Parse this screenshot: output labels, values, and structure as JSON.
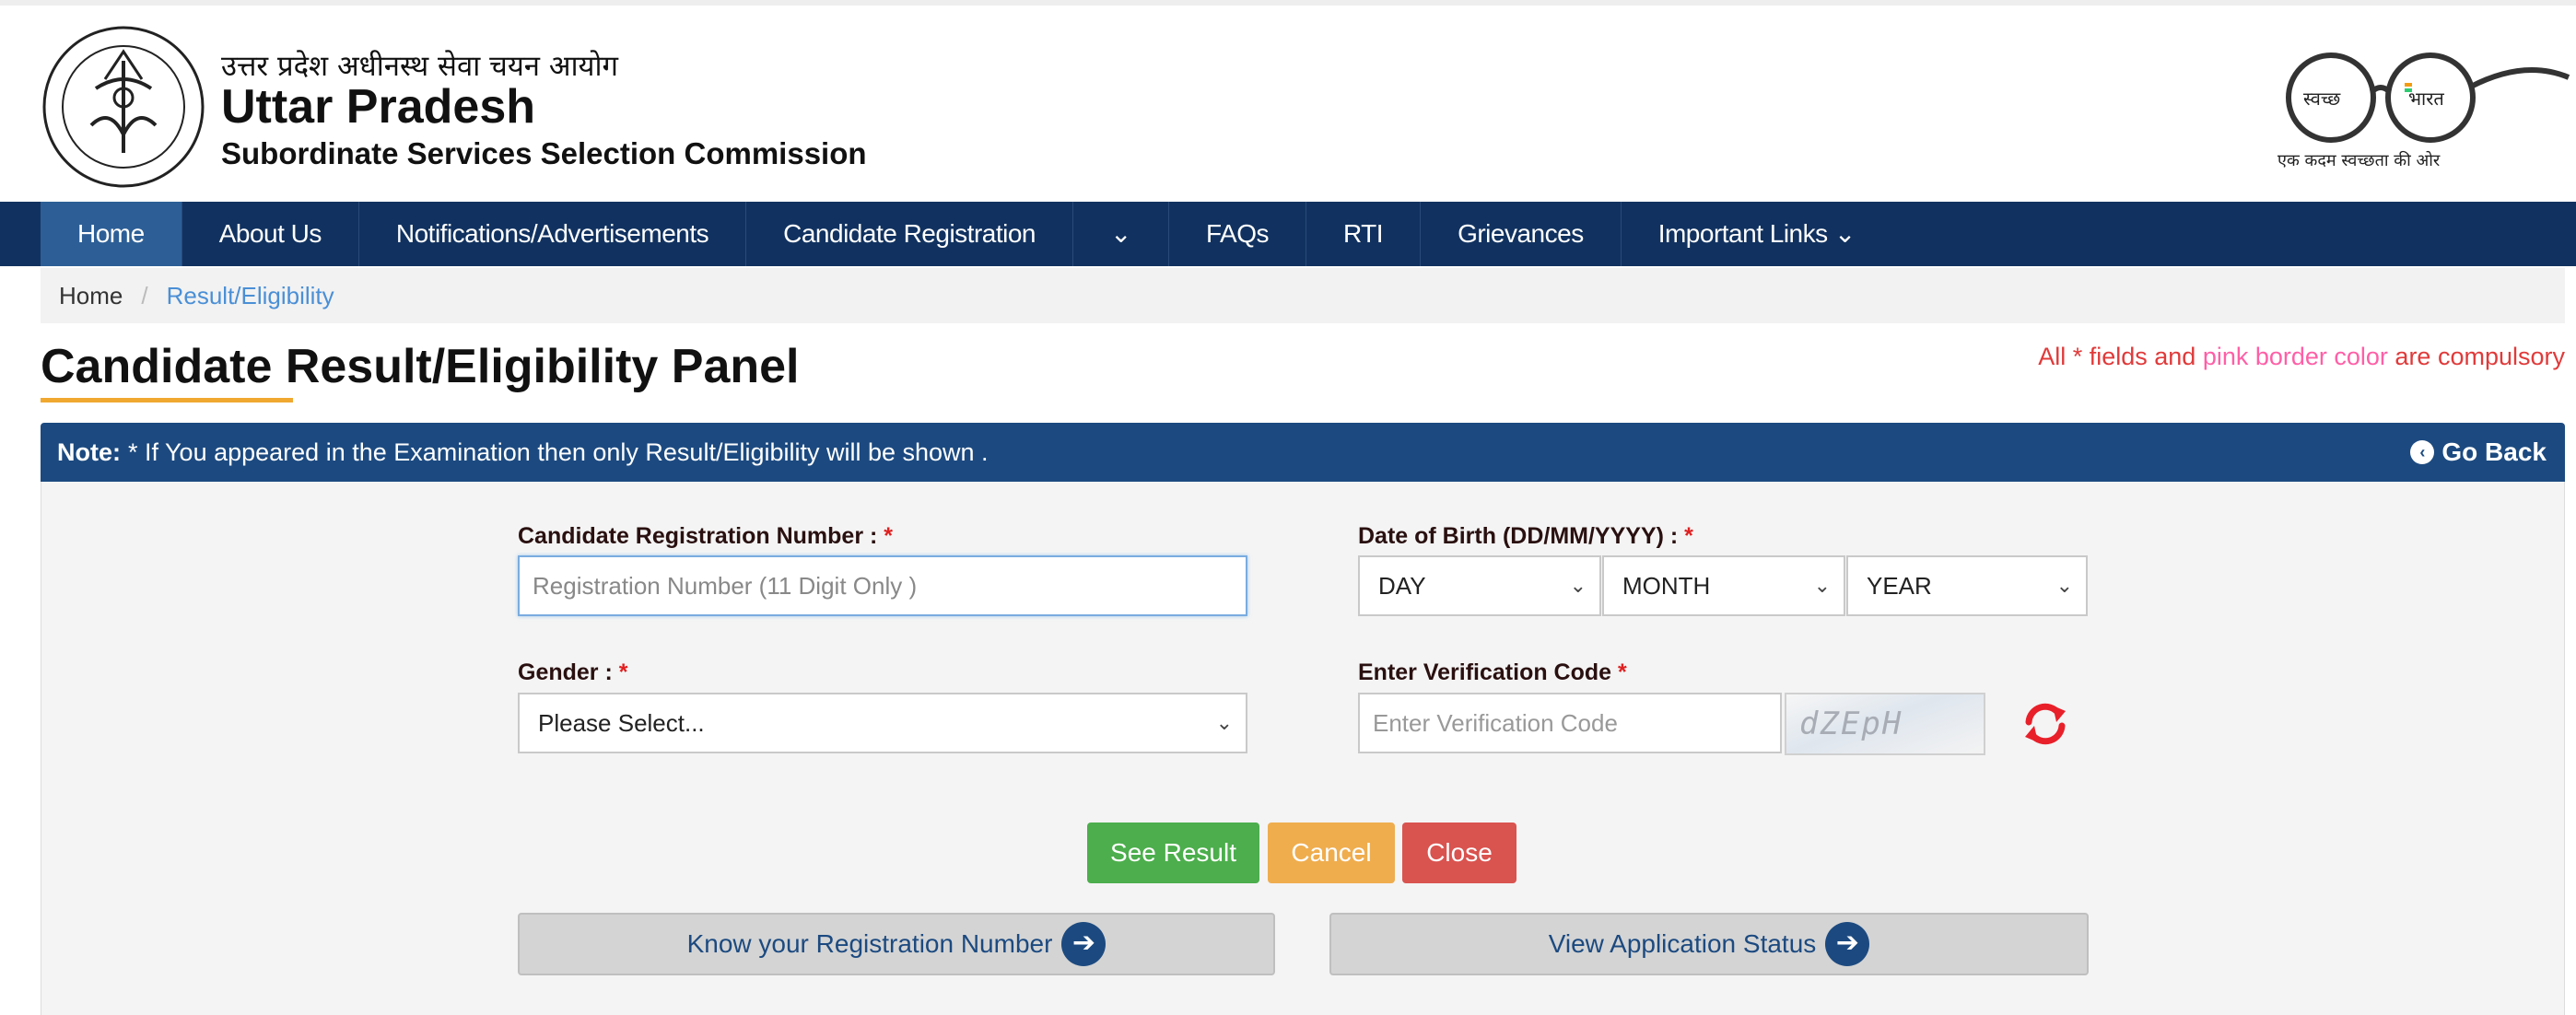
{
  "header": {
    "hindi_title": "उत्तर प्रदेश अधीनस्थ सेवा चयन आयोग",
    "title": "Uttar Pradesh",
    "subtitle": "Subordinate Services Selection Commission",
    "swachh_left": "स्वच्छ",
    "swachh_right": "भारत",
    "swachh_tagline": "एक कदम स्वच्छता की ओर"
  },
  "nav": {
    "items": [
      {
        "label": "Home",
        "active": true
      },
      {
        "label": "About Us"
      },
      {
        "label": "Notifications/Advertisements"
      },
      {
        "label": "Candidate Registration"
      },
      {
        "label": "⌄"
      },
      {
        "label": "FAQs"
      },
      {
        "label": "RTI"
      },
      {
        "label": "Grievances"
      },
      {
        "label": "Important Links ⌄"
      }
    ]
  },
  "breadcrumb": {
    "home": "Home",
    "separator": "/",
    "current": "Result/Eligibility"
  },
  "page": {
    "title": "Candidate Result/Eligibility Panel",
    "compulsory_prefix": "All * fields and ",
    "compulsory_pink": "pink border color",
    "compulsory_suffix": " are compulsory"
  },
  "note": {
    "label": "Note:",
    "text": "* If You appeared in the Examination then only Result/Eligibility will be shown .",
    "go_back": "Go Back"
  },
  "form": {
    "reg_label": "Candidate Registration Number : ",
    "reg_placeholder": "Registration Number (11 Digit Only )",
    "dob_label": "Date of Birth (DD/MM/YYYY) : ",
    "day": "DAY",
    "month": "MONTH",
    "year": "YEAR",
    "gender_label": "Gender : ",
    "gender_value": "Please Select...",
    "verify_label": "Enter Verification Code ",
    "verify_placeholder": "Enter Verification Code",
    "captcha_text": "dZEpH",
    "required_mark": "*"
  },
  "buttons": {
    "see_result": "See Result",
    "cancel": "Cancel",
    "close": "Close",
    "know_reg": "Know your Registration Number",
    "view_status": "View Application Status"
  },
  "colors": {
    "nav_bg": "#113260",
    "note_bg": "#1c4a80",
    "accent_underline": "#f0a830",
    "compulsory_red": "#e03a3a",
    "compulsory_pink": "#ff5fa7"
  }
}
